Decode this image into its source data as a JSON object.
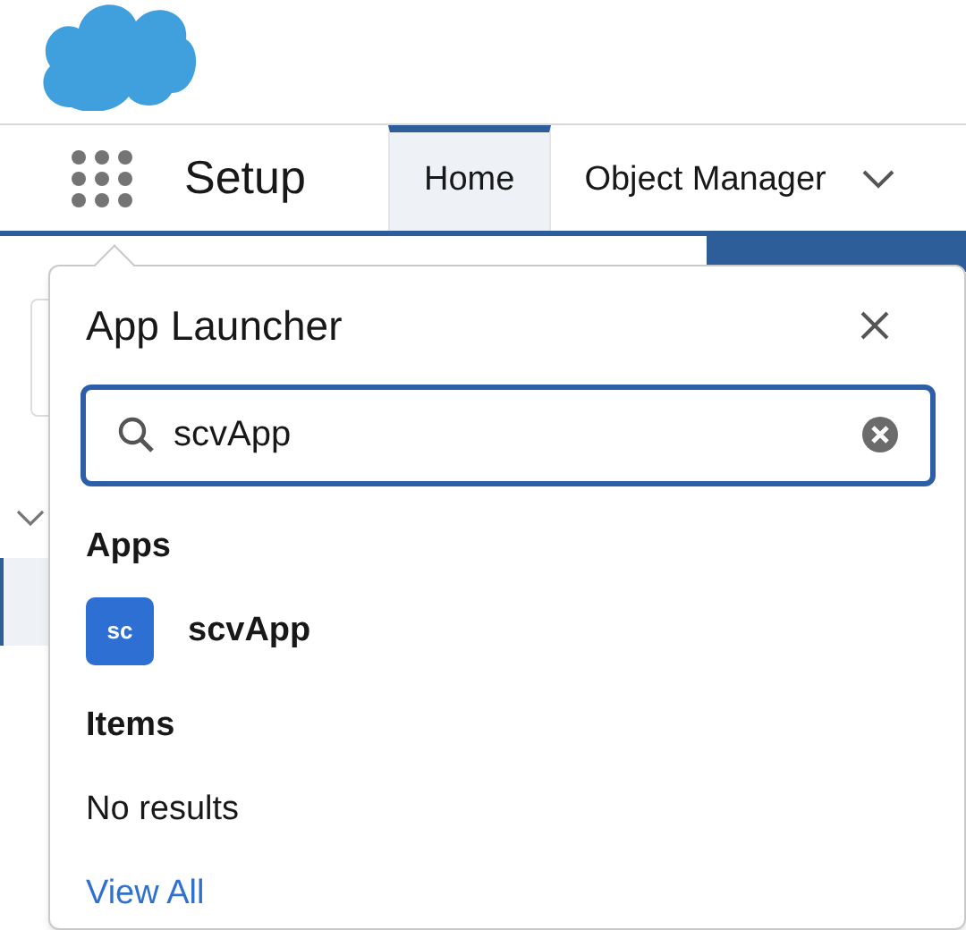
{
  "header": {
    "title": "Setup"
  },
  "tabs": [
    {
      "label": "Home",
      "selected": true
    },
    {
      "label": "Object Manager",
      "selected": false
    }
  ],
  "app_launcher": {
    "title": "App Launcher",
    "search": {
      "value": "scvApp"
    },
    "sections": [
      {
        "heading": "Apps",
        "kind": "apps",
        "items": [
          {
            "badge": "sc",
            "label": "scvApp",
            "color": "#2e6fd3"
          }
        ]
      },
      {
        "heading": "Items",
        "kind": "empty",
        "message": "No results"
      }
    ],
    "link": "View All"
  }
}
